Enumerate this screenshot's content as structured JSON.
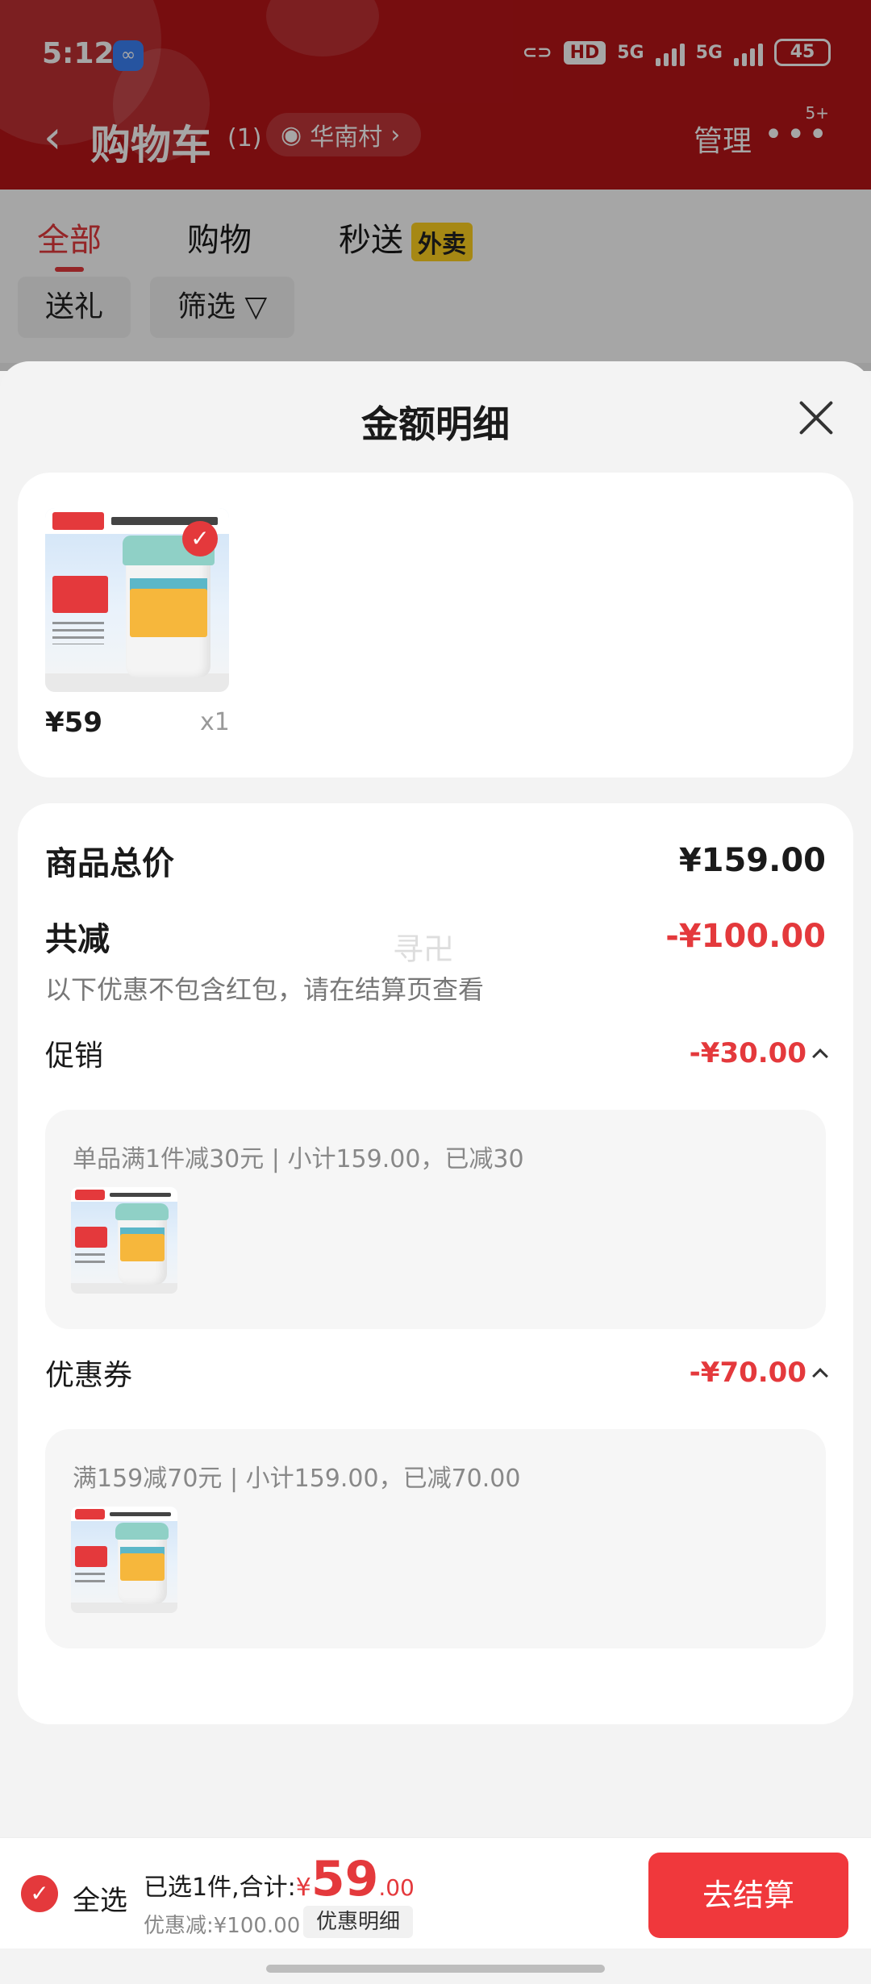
{
  "status_bar": {
    "time": "5:12",
    "hd": "HD",
    "network1": "5G",
    "network2": "5G",
    "battery": "45"
  },
  "nav": {
    "title": "购物车",
    "count": "(1)",
    "location": "华南村",
    "manage": "管理",
    "more_badge": "5+"
  },
  "tabs": [
    {
      "label": "全部"
    },
    {
      "label": "购物"
    },
    {
      "label": "秒送",
      "badge": "外卖"
    }
  ],
  "chips": {
    "gift": "送礼",
    "filter": "筛选"
  },
  "sheet": {
    "title": "金额明细",
    "item": {
      "price": "¥59",
      "qty": "x1"
    },
    "total_label": "商品总价",
    "total_value": "¥159.00",
    "reduce_label": "共减",
    "reduce_value": "-¥100.00",
    "note": "以下优惠不包含红包，请在结算页查看",
    "watermark": "寻卍",
    "promo": {
      "label": "促销",
      "value": "-¥30.00",
      "desc": "单品满1件减30元 | 小计159.00，已减30"
    },
    "coupon": {
      "label": "优惠券",
      "value": "-¥70.00",
      "desc": "满159减70元 | 小计159.00，已减70.00"
    }
  },
  "bottom": {
    "select_all": "全选",
    "summary_prefix": "已选1件,合计:",
    "currency": "¥",
    "amount_int": "59",
    "amount_dec": ".00",
    "discount": "优惠减:¥100.00",
    "detail": "优惠明细",
    "checkout": "去结算"
  },
  "colors": {
    "accent": "#e4393c",
    "header": "#b71418",
    "badge_yellow": "#ffd21f"
  }
}
